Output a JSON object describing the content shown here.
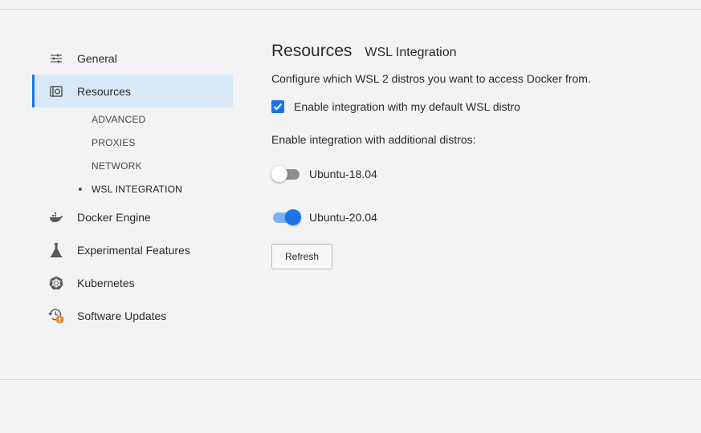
{
  "sidebar": {
    "items": [
      {
        "label": "General",
        "icon": "sliders-icon"
      },
      {
        "label": "Resources",
        "icon": "resources-icon"
      },
      {
        "label": "Docker Engine",
        "icon": "whale-icon"
      },
      {
        "label": "Experimental Features",
        "icon": "flask-icon"
      },
      {
        "label": "Kubernetes",
        "icon": "helm-wheel-icon"
      },
      {
        "label": "Software Updates",
        "icon": "update-clock-icon"
      }
    ],
    "subitems": [
      "ADVANCED",
      "PROXIES",
      "NETWORK",
      "WSL INTEGRATION"
    ]
  },
  "main": {
    "title": "Resources",
    "subtitle": "WSL Integration",
    "description": "Configure which WSL 2 distros you want to access Docker from.",
    "default_checkbox": {
      "label": "Enable integration with my default WSL distro",
      "checked": true
    },
    "additional_label": "Enable integration with additional distros:",
    "distros": [
      {
        "name": "Ubuntu-18.04",
        "enabled": false
      },
      {
        "name": "Ubuntu-20.04",
        "enabled": true
      }
    ],
    "refresh_label": "Refresh"
  },
  "colors": {
    "accent": "#1a73e8",
    "active_bg": "#d7e9f7",
    "warning_badge": "#e8893c"
  }
}
